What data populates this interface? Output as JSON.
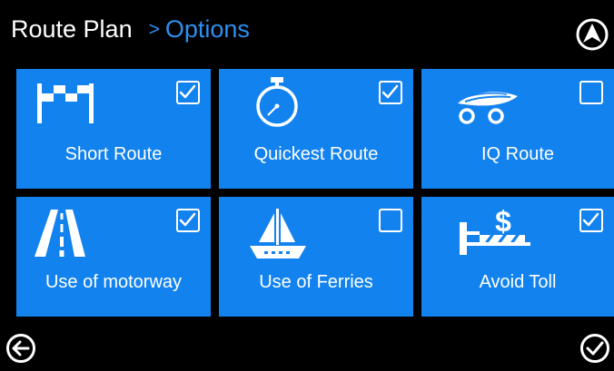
{
  "header": {
    "title": "Route Plan",
    "separator": ">",
    "subtitle": "Options"
  },
  "colors": {
    "tile_bg": "#1282ef",
    "accent_text": "#2e8ff0",
    "background": "#000000"
  },
  "options": [
    {
      "label": "Short Route",
      "icon": "checkered-flag-icon",
      "checked": true
    },
    {
      "label": "Quickest Route",
      "icon": "stopwatch-icon",
      "checked": true
    },
    {
      "label": "IQ Route",
      "icon": "iq-car-icon",
      "checked": false
    },
    {
      "label": "Use of motorway",
      "icon": "motorway-road-icon",
      "checked": true
    },
    {
      "label": "Use of Ferries",
      "icon": "ferry-boat-icon",
      "checked": false
    },
    {
      "label": "Avoid Toll",
      "icon": "toll-barrier-icon",
      "checked": true
    }
  ],
  "footer": {
    "back_icon": "back-arrow-icon",
    "confirm_icon": "confirm-check-icon"
  }
}
